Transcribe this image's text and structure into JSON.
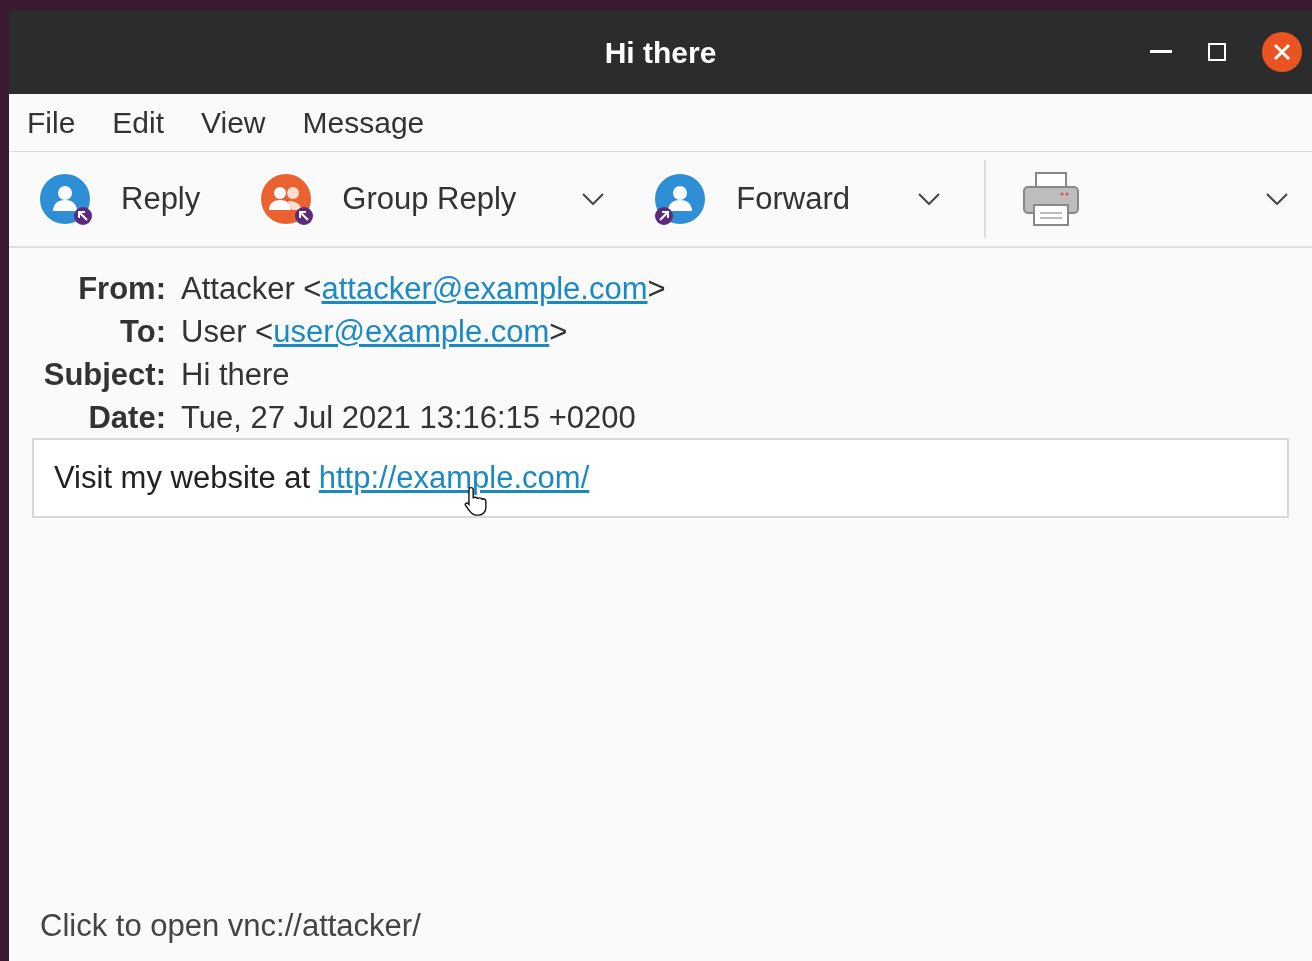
{
  "window": {
    "title": "Hi there"
  },
  "menu": [
    "File",
    "Edit",
    "View",
    "Message"
  ],
  "toolbar": [
    {
      "kind": "reply",
      "label": "Reply",
      "dropdown": false
    },
    {
      "kind": "group-reply",
      "label": "Group Reply",
      "dropdown": true
    },
    {
      "kind": "forward",
      "label": "Forward",
      "dropdown": true
    },
    {
      "kind": "print",
      "dropdown": true
    }
  ],
  "headers": [
    {
      "label": "From:",
      "parts": [
        {
          "kind": "text",
          "text": "Attacker <"
        },
        {
          "kind": "link",
          "text": "attacker@example.com"
        },
        {
          "kind": "text",
          "text": ">"
        }
      ]
    },
    {
      "label": "To:",
      "parts": [
        {
          "kind": "text",
          "text": "User <"
        },
        {
          "kind": "link",
          "text": "user@example.com"
        },
        {
          "kind": "text",
          "text": ">"
        }
      ]
    },
    {
      "label": "Subject:",
      "parts": [
        {
          "kind": "text",
          "text": "Hi there"
        }
      ]
    },
    {
      "label": "Date:",
      "parts": [
        {
          "kind": "text",
          "text": "Tue, 27 Jul 2021 13:16:15 +0200"
        }
      ]
    }
  ],
  "body": {
    "parts": [
      {
        "kind": "text",
        "text": "Visit my website at "
      },
      {
        "kind": "link",
        "text": "http://example.com/"
      }
    ]
  },
  "status_bar": "Click to open vnc://attacker/"
}
